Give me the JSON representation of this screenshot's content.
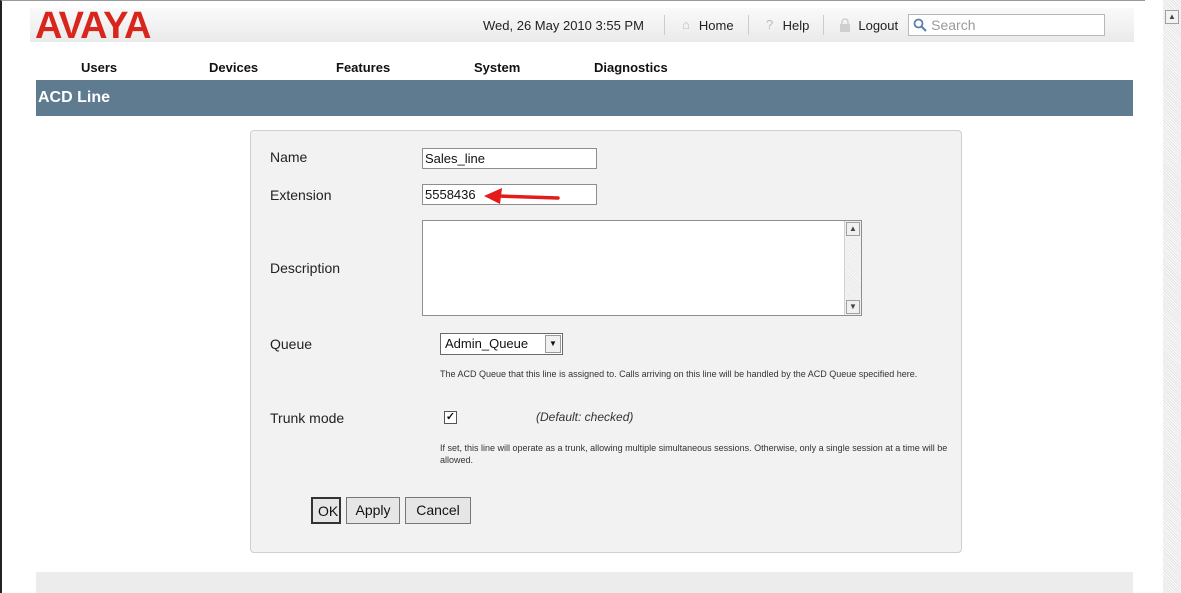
{
  "header": {
    "logo_text": "AVAYA",
    "date": "Wed, 26 May 2010 3:55 PM",
    "links": [
      {
        "label": "Home",
        "icon": "home-icon"
      },
      {
        "label": "Help",
        "icon": "help-icon"
      },
      {
        "label": "Logout",
        "icon": "lock-icon"
      }
    ],
    "search_placeholder": "Search"
  },
  "nav": {
    "items": [
      "Users",
      "Devices",
      "Features",
      "System",
      "Diagnostics"
    ]
  },
  "page_title": "ACD Line",
  "form": {
    "name_label": "Name",
    "name_value": "Sales_line",
    "extension_label": "Extension",
    "extension_value": "5558436",
    "description_label": "Description",
    "description_value": "",
    "queue_label": "Queue",
    "queue_value": "Admin_Queue",
    "queue_help": "The ACD Queue that this line is assigned to. Calls arriving on this line will be handled by the ACD Queue specified here.",
    "trunk_label": "Trunk mode",
    "trunk_checked": true,
    "trunk_default": "(Default: checked)",
    "trunk_help": "If set, this line will operate as a trunk, allowing multiple simultaneous sessions. Otherwise, only a single session at a time will be allowed.",
    "buttons": {
      "ok": "OK",
      "apply": "Apply",
      "cancel": "Cancel"
    }
  },
  "colors": {
    "brand": "#d9261c",
    "titlebar": "#5f7b90",
    "annotation_arrow": "#e31b1b"
  }
}
